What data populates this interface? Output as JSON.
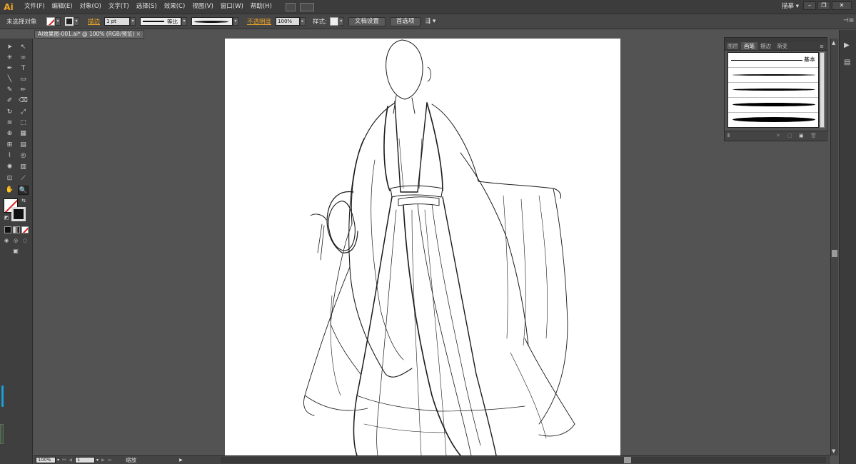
{
  "app": {
    "logo": "Ai",
    "workspace": "描摹"
  },
  "menu": [
    "文件(F)",
    "编辑(E)",
    "对象(O)",
    "文字(T)",
    "选择(S)",
    "效果(C)",
    "视图(V)",
    "窗口(W)",
    "帮助(H)"
  ],
  "control": {
    "selection": "未选择对象",
    "stroke_link": "描边",
    "stroke_weight": "1 pt",
    "profile_label": "等比",
    "opacity_link": "不透明度",
    "opacity_value": "100%",
    "style_label": "样式:",
    "doc_setup": "文档设置",
    "preferences": "首选项"
  },
  "document": {
    "tab_title": "AI效果图-001.ai* @ 100% (RGB/预览)",
    "close": "×"
  },
  "status": {
    "zoom": "100%",
    "page": "1",
    "tool_name": "缩放"
  },
  "brushes_panel": {
    "tabs": [
      "图层",
      "画笔",
      "描边",
      "渐变"
    ],
    "active_tab": "画笔",
    "basic_label": "基本"
  },
  "window_controls": [
    "–",
    "❐",
    "✕"
  ],
  "colors": {
    "accent": "#e9a227",
    "logo": "#f5a623",
    "ui_dark": "#3c3c3c"
  }
}
